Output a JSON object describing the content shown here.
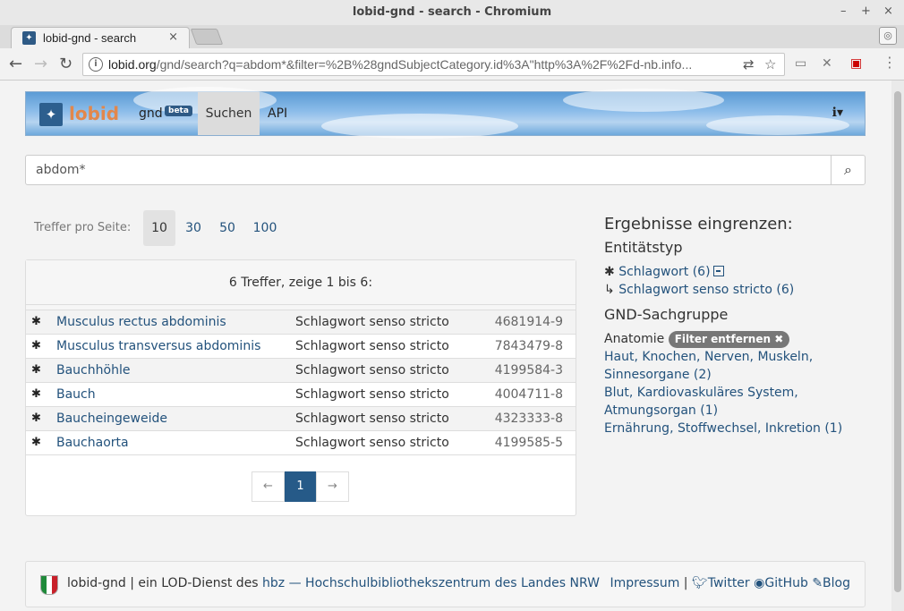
{
  "window": {
    "title": "lobid-gnd - search - Chromium",
    "controls": [
      "–",
      "+",
      "×"
    ]
  },
  "tab": {
    "title": "lobid-gnd - search",
    "close": "×"
  },
  "omnibox": {
    "host": "lobid.org",
    "path": "/gnd/search?q=abdom*&filter=%2B%28gndSubjectCategory.id%3A\"http%3A%2F%2Fd-nb.info..."
  },
  "site": {
    "logo": "lobid",
    "nav": {
      "gnd": "gnd",
      "beta": "beta",
      "suchen": "Suchen",
      "api": "API"
    }
  },
  "search": {
    "value": "abdom*"
  },
  "per_page": {
    "label": "Treffer pro Seite:",
    "options": [
      "10",
      "30",
      "50",
      "100"
    ],
    "selected": "10"
  },
  "results": {
    "summary": "6 Treffer, zeige 1 bis 6:",
    "rows": [
      {
        "name": "Musculus rectus abdominis",
        "type": "Schlagwort senso stricto",
        "id": "4681914-9"
      },
      {
        "name": "Musculus transversus abdominis",
        "type": "Schlagwort senso stricto",
        "id": "7843479-8"
      },
      {
        "name": "Bauchhöhle",
        "type": "Schlagwort senso stricto",
        "id": "4199584-3"
      },
      {
        "name": "Bauch",
        "type": "Schlagwort senso stricto",
        "id": "4004711-8"
      },
      {
        "name": "Baucheingeweide",
        "type": "Schlagwort senso stricto",
        "id": "4323333-8"
      },
      {
        "name": "Bauchaorta",
        "type": "Schlagwort senso stricto",
        "id": "4199585-5"
      }
    ],
    "pager": {
      "prev": "←",
      "current": "1",
      "next": "→"
    }
  },
  "facets": {
    "heading": "Ergebnisse eingrenzen:",
    "entity_heading": "Entitätstyp",
    "entity_item": "Schlagwort (6)",
    "entity_sub_arrow": "↳",
    "entity_sub": "Schlagwort senso stricto (6)",
    "category_heading": "GND-Sachgruppe",
    "active_category": "Anatomie",
    "remove_filter": "Filter entfernen",
    "categories": [
      "Haut, Knochen, Nerven, Muskeln, Sinnesorgane (2)",
      "Blut, Kardiovaskuläres System, Atmungsorgan (1)",
      "Ernährung, Stoffwechsel, Inkretion (1)"
    ]
  },
  "footer": {
    "prefix": "lobid-gnd | ein LOD-Dienst des ",
    "hbz_link": "hbz — Hochschulbibliothekszentrum des Landes NRW",
    "impressum": "Impressum",
    "sep": "|",
    "twitter": "Twitter",
    "github": "GitHub",
    "blog": "Blog"
  },
  "colors": {
    "link": "#23527c",
    "active_page": "#265a88",
    "logo_orange": "#e2874b"
  }
}
